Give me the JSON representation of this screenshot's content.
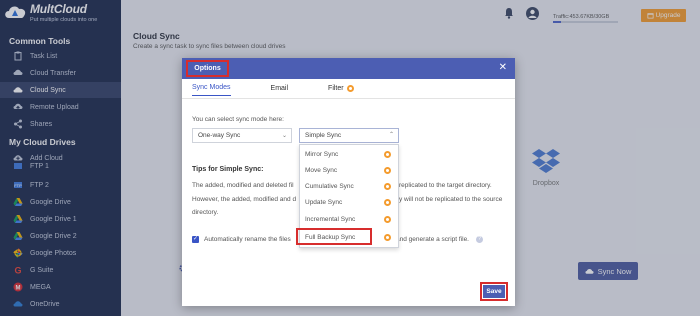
{
  "brand": {
    "name": "MultCloud",
    "tagline": "Put multiple clouds into one"
  },
  "sidebar": {
    "common_tools_title": "Common Tools",
    "common_tools": [
      {
        "label": "Task List",
        "icon": "clipboard-icon"
      },
      {
        "label": "Cloud Transfer",
        "icon": "cloud-transfer-icon"
      },
      {
        "label": "Cloud Sync",
        "icon": "cloud-sync-icon",
        "active": true
      },
      {
        "label": "Remote Upload",
        "icon": "upload-icon"
      },
      {
        "label": "Shares",
        "icon": "share-icon"
      }
    ],
    "drives_title": "My Cloud Drives",
    "drives": [
      {
        "label": "Add Cloud",
        "icon": "add-cloud-icon"
      },
      {
        "label": "FTP 1",
        "icon": "ftp-icon"
      },
      {
        "label": "FTP 2",
        "icon": "ftp-icon"
      },
      {
        "label": "Google Drive",
        "icon": "google-drive-icon"
      },
      {
        "label": "Google Drive 1",
        "icon": "google-drive-icon"
      },
      {
        "label": "Google Drive 2",
        "icon": "google-drive-icon"
      },
      {
        "label": "Google Photos",
        "icon": "google-photos-icon"
      },
      {
        "label": "G Suite",
        "icon": "g-suite-icon"
      },
      {
        "label": "MEGA",
        "icon": "mega-icon"
      },
      {
        "label": "OneDrive",
        "icon": "onedrive-icon"
      }
    ]
  },
  "header": {
    "traffic": "Traffic:453.67KB/30GB",
    "traffic_fraction": 0.12,
    "upgrade_label": "Upgrade"
  },
  "main": {
    "title": "Cloud Sync",
    "subtitle": "Create a sync task to sync files between cloud drives",
    "target_label": "Dropbox",
    "sync_now_label": "Sync Now"
  },
  "modal": {
    "title": "Options",
    "tabs": [
      {
        "label": "Sync Modes",
        "active": true
      },
      {
        "label": "Email"
      },
      {
        "label": "Filter",
        "badge": true
      }
    ],
    "hint": "You can select sync mode here:",
    "mode_select": "One-way Sync",
    "type_select": "Simple Sync",
    "tips_title": "Tips for Simple Sync:",
    "tips_line1_left": "The added, modified and deleted fil",
    "tips_line1_right": "replicated to the target directory.",
    "tips_line2_left": "However, the added, modified and d",
    "tips_line2_right": "y will not be replicated to the source",
    "tips_line3": "directory.",
    "auto_rename_left": "Automatically rename the files",
    "auto_rename_right": "and generate a script file.",
    "save_label": "Save",
    "sync_types": [
      "Mirror Sync",
      "Move Sync",
      "Cumulative Sync",
      "Update Sync",
      "Incremental Sync",
      "Full Backup Sync"
    ]
  },
  "colors": {
    "sidebar_bg": "#1d2a4d",
    "accent": "#4c5eb3",
    "highlight_border": "#d72d2d",
    "premium_badge": "#f49b2d"
  }
}
